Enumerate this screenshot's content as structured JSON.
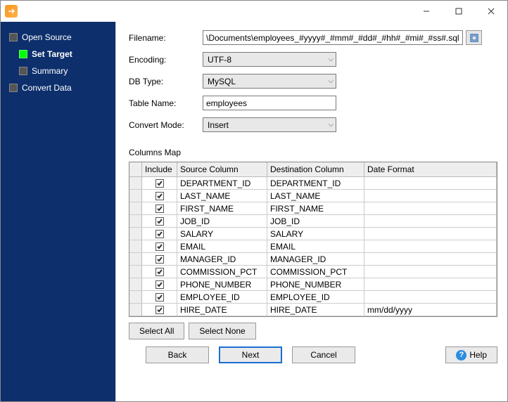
{
  "nav": {
    "items": [
      {
        "label": "Open Source",
        "active": false,
        "indent": 0
      },
      {
        "label": "Set Target",
        "active": true,
        "indent": 1
      },
      {
        "label": "Summary",
        "active": false,
        "indent": 1
      },
      {
        "label": "Convert Data",
        "active": false,
        "indent": 0
      }
    ]
  },
  "form": {
    "filename_label": "Filename:",
    "filename_value": "\\Documents\\employees_#yyyy#_#mm#_#dd#_#hh#_#mi#_#ss#.sql",
    "encoding_label": "Encoding:",
    "encoding_value": "UTF-8",
    "dbtype_label": "DB Type:",
    "dbtype_value": "MySQL",
    "tablename_label": "Table Name:",
    "tablename_value": "employees",
    "convertmode_label": "Convert Mode:",
    "convertmode_value": "Insert"
  },
  "columns_map": {
    "label": "Columns Map",
    "headers": {
      "include": "Include",
      "source": "Source Column",
      "dest": "Destination Column",
      "date": "Date Format"
    },
    "rows": [
      {
        "inc": true,
        "src": "DEPARTMENT_ID",
        "dst": "DEPARTMENT_ID",
        "date": ""
      },
      {
        "inc": true,
        "src": "LAST_NAME",
        "dst": "LAST_NAME",
        "date": ""
      },
      {
        "inc": true,
        "src": "FIRST_NAME",
        "dst": "FIRST_NAME",
        "date": ""
      },
      {
        "inc": true,
        "src": "JOB_ID",
        "dst": "JOB_ID",
        "date": ""
      },
      {
        "inc": true,
        "src": "SALARY",
        "dst": "SALARY",
        "date": ""
      },
      {
        "inc": true,
        "src": "EMAIL",
        "dst": "EMAIL",
        "date": ""
      },
      {
        "inc": true,
        "src": "MANAGER_ID",
        "dst": "MANAGER_ID",
        "date": ""
      },
      {
        "inc": true,
        "src": "COMMISSION_PCT",
        "dst": "COMMISSION_PCT",
        "date": ""
      },
      {
        "inc": true,
        "src": "PHONE_NUMBER",
        "dst": "PHONE_NUMBER",
        "date": ""
      },
      {
        "inc": true,
        "src": "EMPLOYEE_ID",
        "dst": "EMPLOYEE_ID",
        "date": ""
      },
      {
        "inc": true,
        "src": "HIRE_DATE",
        "dst": "HIRE_DATE",
        "date": "mm/dd/yyyy"
      }
    ]
  },
  "buttons": {
    "select_all": "Select All",
    "select_none": "Select None",
    "back": "Back",
    "next": "Next",
    "cancel": "Cancel",
    "help": "Help"
  }
}
